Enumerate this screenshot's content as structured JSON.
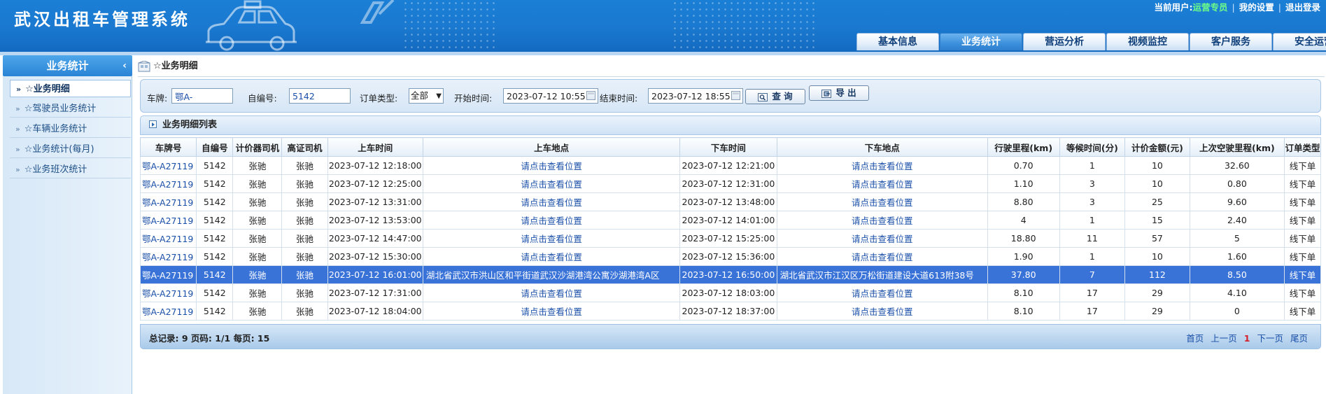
{
  "app": {
    "title": "武汉出租车管理系统"
  },
  "user_bar": {
    "current_user_label": "当前用户:",
    "current_user_name": "运营专员",
    "my_settings": "我的设置",
    "logout": "退出登录"
  },
  "nav": {
    "tabs": [
      {
        "label": "基本信息"
      },
      {
        "label": "业务统计"
      },
      {
        "label": "营运分析"
      },
      {
        "label": "视频监控"
      },
      {
        "label": "客户服务"
      },
      {
        "label": "安全运营"
      }
    ],
    "active_index": 1
  },
  "sidebar": {
    "title": "业务统计",
    "collapse_glyph": "‹",
    "items": [
      {
        "label": "☆业务明细"
      },
      {
        "label": "☆驾驶员业务统计"
      },
      {
        "label": "☆车辆业务统计"
      },
      {
        "label": "☆业务统计(每月)"
      },
      {
        "label": "☆业务班次统计"
      }
    ]
  },
  "breadcrumb": {
    "text": "☆业务明细"
  },
  "filters": {
    "plate_label": "车牌:",
    "plate_value": "鄂A-",
    "self_no_label": "自编号:",
    "self_no_value": "5142",
    "order_type_label": "订单类型:",
    "order_type_value": "全部",
    "start_label": "开始时间:",
    "start_value": "2023-07-12 10:55",
    "end_label": "结束时间:",
    "end_value": "2023-07-12 18:55",
    "query_button": "查 询",
    "export_button": "导 出"
  },
  "list": {
    "title": "业务明细列表",
    "columns": [
      "车牌号",
      "自编号",
      "计价器司机",
      "高证司机",
      "上车时间",
      "上车地点",
      "下车时间",
      "下车地点",
      "行驶里程(km)",
      "等候时间(分)",
      "计价金额(元)",
      "上次空驶里程(km)",
      "订单类型"
    ],
    "rows": [
      {
        "plate": "鄂A-A27119",
        "self_no": "5142",
        "meter_driver": "张驰",
        "cert_driver": "张驰",
        "pickup_time": "2023-07-12 12:18:00",
        "pickup_loc": "请点击查看位置",
        "dropoff_time": "2023-07-12 12:21:00",
        "dropoff_loc": "请点击查看位置",
        "mileage": "0.70",
        "wait": "1",
        "amount": "10",
        "empty_mileage": "32.60",
        "order_type": "线下单"
      },
      {
        "plate": "鄂A-A27119",
        "self_no": "5142",
        "meter_driver": "张驰",
        "cert_driver": "张驰",
        "pickup_time": "2023-07-12 12:25:00",
        "pickup_loc": "请点击查看位置",
        "dropoff_time": "2023-07-12 12:31:00",
        "dropoff_loc": "请点击查看位置",
        "mileage": "1.10",
        "wait": "3",
        "amount": "10",
        "empty_mileage": "0.80",
        "order_type": "线下单"
      },
      {
        "plate": "鄂A-A27119",
        "self_no": "5142",
        "meter_driver": "张驰",
        "cert_driver": "张驰",
        "pickup_time": "2023-07-12 13:31:00",
        "pickup_loc": "请点击查看位置",
        "dropoff_time": "2023-07-12 13:48:00",
        "dropoff_loc": "请点击查看位置",
        "mileage": "8.80",
        "wait": "3",
        "amount": "25",
        "empty_mileage": "9.60",
        "order_type": "线下单"
      },
      {
        "plate": "鄂A-A27119",
        "self_no": "5142",
        "meter_driver": "张驰",
        "cert_driver": "张驰",
        "pickup_time": "2023-07-12 13:53:00",
        "pickup_loc": "请点击查看位置",
        "dropoff_time": "2023-07-12 14:01:00",
        "dropoff_loc": "请点击查看位置",
        "mileage": "4",
        "wait": "1",
        "amount": "15",
        "empty_mileage": "2.40",
        "order_type": "线下单"
      },
      {
        "plate": "鄂A-A27119",
        "self_no": "5142",
        "meter_driver": "张驰",
        "cert_driver": "张驰",
        "pickup_time": "2023-07-12 14:47:00",
        "pickup_loc": "请点击查看位置",
        "dropoff_time": "2023-07-12 15:25:00",
        "dropoff_loc": "请点击查看位置",
        "mileage": "18.80",
        "wait": "11",
        "amount": "57",
        "empty_mileage": "5",
        "order_type": "线下单"
      },
      {
        "plate": "鄂A-A27119",
        "self_no": "5142",
        "meter_driver": "张驰",
        "cert_driver": "张驰",
        "pickup_time": "2023-07-12 15:30:00",
        "pickup_loc": "请点击查看位置",
        "dropoff_time": "2023-07-12 15:36:00",
        "dropoff_loc": "请点击查看位置",
        "mileage": "1.90",
        "wait": "1",
        "amount": "10",
        "empty_mileage": "1.60",
        "order_type": "线下单"
      },
      {
        "plate": "鄂A-A27119",
        "self_no": "5142",
        "meter_driver": "张驰",
        "cert_driver": "张驰",
        "pickup_time": "2023-07-12 16:01:00",
        "pickup_loc": "湖北省武汉市洪山区和平街道武汉沙湖港湾公寓沙湖港湾A区",
        "dropoff_time": "2023-07-12 16:50:00",
        "dropoff_loc": "湖北省武汉市江汉区万松街道建设大道613附38号",
        "mileage": "37.80",
        "wait": "7",
        "amount": "112",
        "empty_mileage": "8.50",
        "order_type": "线下单",
        "highlighted": true
      },
      {
        "plate": "鄂A-A27119",
        "self_no": "5142",
        "meter_driver": "张驰",
        "cert_driver": "张驰",
        "pickup_time": "2023-07-12 17:31:00",
        "pickup_loc": "请点击查看位置",
        "dropoff_time": "2023-07-12 18:03:00",
        "dropoff_loc": "请点击查看位置",
        "mileage": "8.10",
        "wait": "17",
        "amount": "29",
        "empty_mileage": "4.10",
        "order_type": "线下单"
      },
      {
        "plate": "鄂A-A27119",
        "self_no": "5142",
        "meter_driver": "张驰",
        "cert_driver": "张驰",
        "pickup_time": "2023-07-12 18:04:00",
        "pickup_loc": "请点击查看位置",
        "dropoff_time": "2023-07-12 18:37:00",
        "dropoff_loc": "请点击查看位置",
        "mileage": "8.10",
        "wait": "17",
        "amount": "29",
        "empty_mileage": "0",
        "order_type": "线下单"
      }
    ]
  },
  "pager": {
    "summary": "总记录: 9 页码: 1/1 每页: 15",
    "first": "首页",
    "prev": "上一页",
    "current": "1",
    "next": "下一页",
    "last": "尾页"
  },
  "colors": {
    "header_blue": "#1a78cf",
    "highlight_row": "#3a73d8",
    "link_blue": "#1a4fa8",
    "current_user_green": "#6dff86",
    "current_page_red": "#d4202a"
  }
}
